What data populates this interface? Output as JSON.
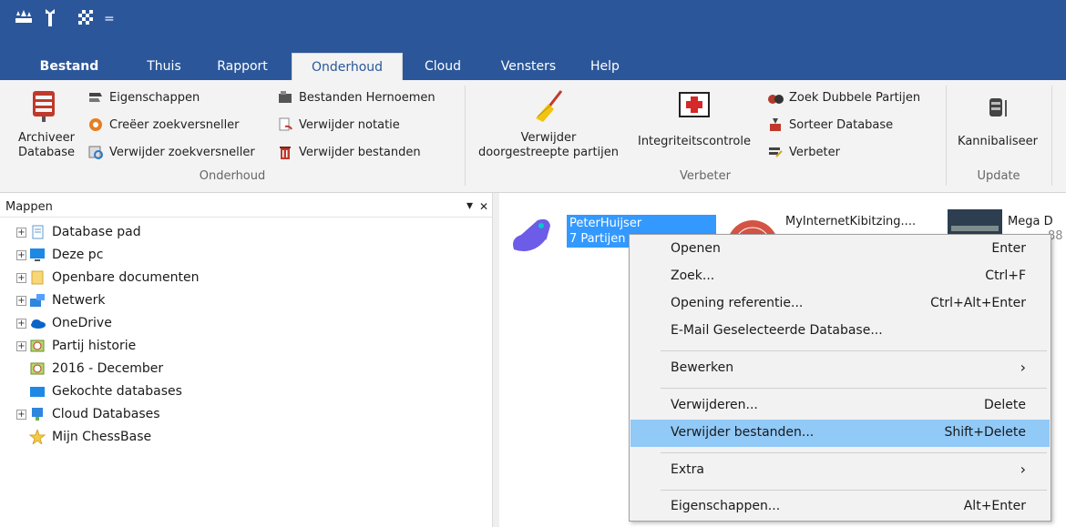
{
  "quick_access": {
    "icons": [
      "chess-pieces-icon",
      "wrench-icon",
      "board-icon",
      "dropdown-arrow-icon"
    ],
    "dropdown_glyph": "="
  },
  "tabs": [
    {
      "label": "Bestand",
      "active": false
    },
    {
      "label": "Thuis",
      "active": false
    },
    {
      "label": "Rapport",
      "active": false
    },
    {
      "label": "Onderhoud",
      "active": true
    },
    {
      "label": "Cloud",
      "active": false
    },
    {
      "label": "Vensters",
      "active": false
    },
    {
      "label": "Help",
      "active": false
    }
  ],
  "ribbon": {
    "onderhoud": {
      "label": "Onderhoud",
      "archive_line1": "Archiveer",
      "archive_line2": "Database",
      "items": [
        "Eigenschappen",
        "Creëer zoekversneller",
        "Verwijder zoekversneller",
        "Bestanden Hernoemen",
        "Verwijder notatie",
        "Verwijder bestanden"
      ]
    },
    "verbeter": {
      "label": "Verbeter",
      "remove_line1": "Verwijder",
      "remove_line2": "doorgestreepte partijen",
      "integrity": "Integriteitscontrole",
      "items": [
        "Zoek Dubbele Partijen",
        "Sorteer Database",
        "Verbeter"
      ]
    },
    "update": {
      "label": "Update",
      "cannibalize": "Kannibaliseer"
    }
  },
  "left_pane": {
    "title": "Mappen",
    "pin_glyph": "▾",
    "close_glyph": "✕",
    "tree": [
      {
        "label": "Database pad",
        "expander": "+"
      },
      {
        "label": "Deze pc",
        "expander": "+"
      },
      {
        "label": "Openbare documenten",
        "expander": "+"
      },
      {
        "label": "Netwerk",
        "expander": "+"
      },
      {
        "label": "OneDrive",
        "expander": "+"
      },
      {
        "label": "Partij historie",
        "expander": "+"
      },
      {
        "label": "2016 - December",
        "expander": ""
      },
      {
        "label": "Gekochte databases",
        "expander": ""
      },
      {
        "label": "Cloud Databases",
        "expander": "+"
      },
      {
        "label": "Mijn ChessBase",
        "expander": ""
      }
    ]
  },
  "databases": [
    {
      "name": "PeterHuijser",
      "sub": "7 Partijen"
    },
    {
      "name": "MyInternetKibitzing....",
      "sub": ""
    },
    {
      "name": "Mega D",
      "sub": "88"
    }
  ],
  "context_menu": {
    "items": [
      {
        "label": "Openen",
        "shortcut": "Enter"
      },
      {
        "label": "Zoek...",
        "shortcut": "Ctrl+F"
      },
      {
        "label": "Opening referentie...",
        "shortcut": "Ctrl+Alt+Enter"
      },
      {
        "label": "E-Mail Geselecteerde Database...",
        "shortcut": ""
      },
      {
        "label": "Bewerken",
        "shortcut": "›"
      },
      {
        "label": "Verwijderen...",
        "shortcut": "Delete"
      },
      {
        "label": "Verwijder bestanden...",
        "shortcut": "Shift+Delete"
      },
      {
        "label": "Extra",
        "shortcut": "›"
      },
      {
        "label": "Eigenschappen...",
        "shortcut": "Alt+Enter"
      }
    ]
  },
  "colors": {
    "titlebar": "#2b579a",
    "highlight": "#91c9f7",
    "selection": "#3399ff"
  }
}
